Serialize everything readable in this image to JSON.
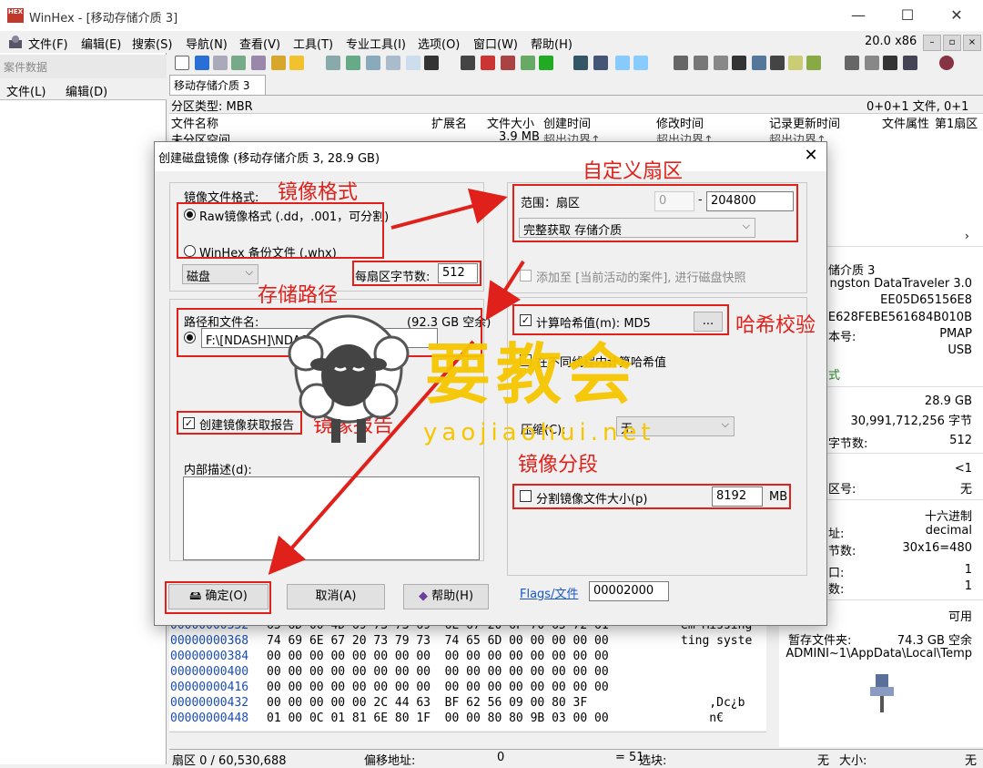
{
  "window": {
    "title": "WinHex - [移动存储介质 3]",
    "app_icon_text": "HEX",
    "controls": [
      "—",
      "☐",
      "✕"
    ]
  },
  "menu": {
    "items": [
      "文件(F)",
      "编辑(E)",
      "搜索(S)",
      "导航(N)",
      "查看(V)",
      "工具(T)",
      "专业工具(I)",
      "选项(O)",
      "窗口(W)",
      "帮助(H)"
    ],
    "version": "20.0 x86",
    "mini_buttons": [
      "–",
      "▫",
      "×"
    ]
  },
  "case_panel": {
    "header": "案件数据",
    "menu_file": "文件(L)",
    "menu_edit": "编辑(D)"
  },
  "document": {
    "tab": "移动存储介质 3",
    "partition_type": "分区类型: MBR",
    "partition_count": "0+0+1 文件, 0+1 分区"
  },
  "file_list": {
    "columns": [
      "文件名称",
      "扩展名",
      "文件大小",
      "创建时间",
      "修改时间",
      "记录更新时间",
      "文件属性",
      "第1扇区"
    ],
    "row": {
      "name": "未分区空间",
      "size": "3.9 MB",
      "created": "超出边界↑",
      "modified": "超出边界↑",
      "updated": "超出边界↑"
    }
  },
  "info_panel": {
    "lines": [
      {
        "text": "储介质 3",
        "align": "left"
      },
      {
        "text": "ngston DataTraveler 3.0",
        "align": "right"
      },
      {
        "text": "EE05D65156E8",
        "align": "right"
      },
      {
        "text": "5E628FEBE561684B010B",
        "align": "right"
      },
      {
        "text": "本号:",
        "align": "left",
        "value": "PMAP"
      },
      {
        "text": "",
        "align": "left",
        "value": "USB"
      },
      {
        "text": "式",
        "align": "left",
        "green": true
      },
      {
        "text": "",
        "align": "left",
        "value": "28.9 GB"
      },
      {
        "text": "",
        "align": "left",
        "value": "30,991,712,256 字节"
      },
      {
        "text": "字节数:",
        "align": "left",
        "value": "512"
      },
      {
        "text": "",
        "align": "left",
        "value": "<1"
      },
      {
        "text": "区号:",
        "align": "left",
        "value": "无"
      },
      {
        "text": "",
        "align": "left",
        "value": "十六进制"
      },
      {
        "text": "址:",
        "align": "left",
        "value": "decimal"
      },
      {
        "text": "节数:",
        "align": "left",
        "value": "30x16=480"
      },
      {
        "text": "口:",
        "align": "left",
        "value": "1"
      },
      {
        "text": "数:",
        "align": "left",
        "value": "1"
      },
      {
        "text": "",
        "align": "left",
        "value": "可用"
      },
      {
        "text": "暂存文件夹:",
        "align": "left",
        "value": "74.3 GB 空余"
      },
      {
        "text": "ADMINI~1\\AppData\\Local\\Temp",
        "align": "right"
      }
    ]
  },
  "hex": {
    "rows": [
      {
        "offset": "00000000352",
        "bytes": "65 6D 00 4D 69 73 73 69  6E 67 20 6F 70 65 72 61",
        "text": "em Missing"
      },
      {
        "offset": "00000000368",
        "bytes": "74 69 6E 67 20 73 79 73  74 65 6D 00 00 00 00 00",
        "text": "ting syste"
      },
      {
        "offset": "00000000384",
        "bytes": "00 00 00 00 00 00 00 00  00 00 00 00 00 00 00 00",
        "text": ""
      },
      {
        "offset": "00000000400",
        "bytes": "00 00 00 00 00 00 00 00  00 00 00 00 00 00 00 00",
        "text": ""
      },
      {
        "offset": "00000000416",
        "bytes": "00 00 00 00 00 00 00 00  00 00 00 00 00 00 00 00",
        "text": ""
      },
      {
        "offset": "00000000432",
        "bytes": "00 00 00 00 00 2C 44 63  BF 62 56 09 00 80 3F",
        "text": "    ,Dc¿b"
      },
      {
        "offset": "00000000448",
        "bytes": "01 00 0C 01 81 6E 80 1F  00 00 80 80 9B 03 00 00",
        "text": "    n€"
      }
    ]
  },
  "status": {
    "sector": "扇区 0 / 60,530,688",
    "offset_label": "偏移地址:",
    "offset_value": "0",
    "eq": "= 51",
    "selection": "选块:",
    "none": "无",
    "size": "大小:",
    "none2": "无"
  },
  "dialog": {
    "title": "创建磁盘镜像 (移动存储介质 3, 28.9 GB)",
    "close": "✕",
    "format_group_label": "镜像文件格式:",
    "format_raw": "Raw镜像格式 (.dd，.001，可分割)",
    "format_whx": "WinHex 备份文件 (.whx)",
    "disk_combo": "磁盘",
    "bytes_per_sector_label": "每扇区字节数:",
    "bytes_per_sector_value": "512",
    "path_label": "路径和文件名:",
    "free_space": "(92.3 GB 空余)",
    "path_value": "F:\\[NDASH]\\NDASH首部镜像.001",
    "report_label": "创建镜像获取报告",
    "desc_label": "内部描述(d):",
    "range_label": "范围：扇区",
    "range_start": "0",
    "range_dash": "-",
    "range_end": "204800",
    "acquire_combo": "完整获取 存储介质",
    "add_case_label": "添加至 [当前活动的案件], 进行磁盘快照",
    "hash_label": "计算哈希值(m): MD5",
    "hash_btn": "...",
    "thread_label": "在不同线程内计算哈希值",
    "compress_label": "压缩(C):",
    "compress_value": "无",
    "split_label": "分割镜像文件大小(p)",
    "split_value": "8192",
    "split_unit": "MB",
    "flags_link": "Flags/文件",
    "flags_value": "00002000",
    "ok_btn": "确定(O)",
    "cancel_btn": "取消(A)",
    "help_btn": "帮助(H)"
  },
  "annotations": {
    "format": "镜像格式",
    "custom_sector": "自定义扇区",
    "storage_path": "存储路径",
    "hash_check": "哈希校验",
    "image_report": "镜像报告",
    "image_split": "镜像分段",
    "color": "#e0211b"
  },
  "watermark": {
    "text": "要教会",
    "url": "yaojiaohui.net",
    "color": "#f7c600"
  }
}
